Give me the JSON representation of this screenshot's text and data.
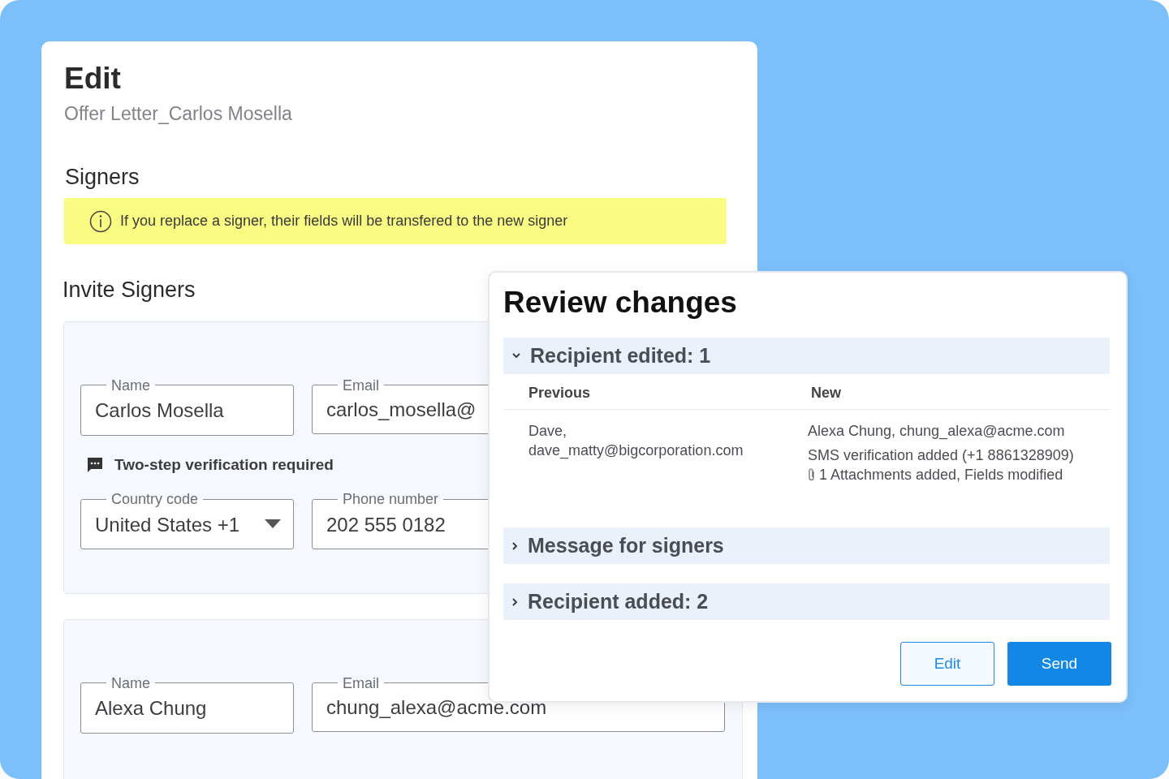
{
  "page": {
    "title": "Edit",
    "subtitle": "Offer Letter_Carlos Mosella"
  },
  "signers_section": {
    "heading": "Signers",
    "notice": "If you replace a signer, their fields will be transfered to the new signer"
  },
  "invite_heading": "Invite Signers",
  "signers": [
    {
      "name": {
        "label": "Name",
        "value": "Carlos Mosella"
      },
      "email": {
        "label": "Email",
        "value": "carlos_mosella@"
      },
      "verification": "Two-step verification required",
      "country": {
        "label": "Country code",
        "value": "United States +1"
      },
      "phone": {
        "label": "Phone number",
        "value": "202 555 0182"
      }
    },
    {
      "name": {
        "label": "Name",
        "value": "Alexa Chung"
      },
      "email": {
        "label": "Email",
        "value": "chung_alexa@acme.com"
      }
    }
  ],
  "dialog": {
    "title": "Review changes",
    "sections": [
      {
        "title": "Recipient edited: 1",
        "expanded": true,
        "columns": [
          "Previous",
          "New"
        ],
        "previous": [
          "Dave,",
          "dave_matty@bigcorporation.com"
        ],
        "new": [
          {
            "kind": "plain",
            "text": "Alexa Chung, chung_alexa@acme.com"
          },
          {
            "kind": "plain",
            "text": "SMS verification added (+1 8861328909)"
          },
          {
            "kind": "attachment",
            "text": "1 Attachments added, Fields modified"
          }
        ]
      },
      {
        "title": "Message for signers",
        "expanded": false
      },
      {
        "title": "Recipient added: 2",
        "expanded": false
      }
    ],
    "buttons": [
      {
        "label": "Edit",
        "kind": "secondary"
      },
      {
        "label": "Send",
        "kind": "primary"
      }
    ]
  }
}
